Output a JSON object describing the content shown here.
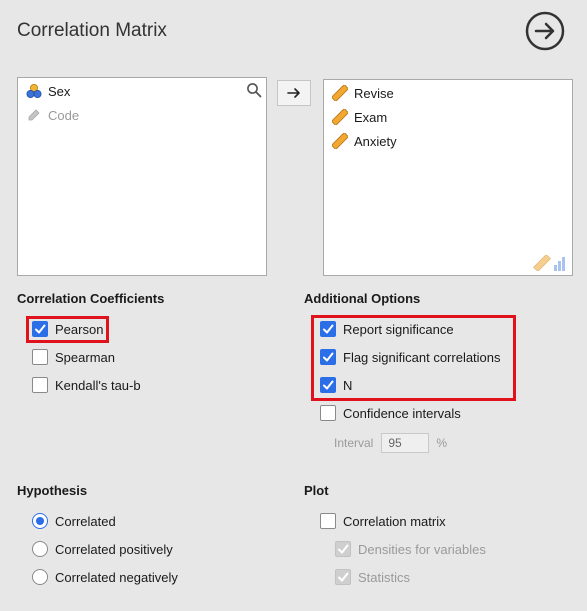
{
  "header": {
    "title": "Correlation Matrix",
    "go_icon": "arrow-circle-right-icon"
  },
  "source_list": {
    "items": [
      {
        "label": "Sex",
        "icon": "nominal-variable-icon"
      },
      {
        "label": "Code",
        "icon": "id-variable-icon",
        "disabled": true
      }
    ],
    "search_icon": "search-icon"
  },
  "transfer_button": {
    "icon": "arrow-right-icon",
    "label": "→"
  },
  "target_list": {
    "items": [
      {
        "label": "Revise",
        "icon": "continuous-variable-icon"
      },
      {
        "label": "Exam",
        "icon": "continuous-variable-icon"
      },
      {
        "label": "Anxiety",
        "icon": "continuous-variable-icon"
      }
    ],
    "allowed_types_icon": "continuous-ordinal-types-icon"
  },
  "correlation_coefficients": {
    "heading": "Correlation Coefficients",
    "options": [
      {
        "label": "Pearson",
        "checked": true
      },
      {
        "label": "Spearman",
        "checked": false
      },
      {
        "label": "Kendall's tau-b",
        "checked": false
      }
    ]
  },
  "additional_options": {
    "heading": "Additional Options",
    "options": [
      {
        "label": "Report significance",
        "checked": true
      },
      {
        "label": "Flag significant correlations",
        "checked": true
      },
      {
        "label": "N",
        "checked": true
      },
      {
        "label": "Confidence intervals",
        "checked": false
      }
    ],
    "interval_label": "Interval",
    "interval_value": "95",
    "interval_unit": "%"
  },
  "hypothesis": {
    "heading": "Hypothesis",
    "options": [
      {
        "label": "Correlated",
        "selected": true
      },
      {
        "label": "Correlated positively",
        "selected": false
      },
      {
        "label": "Correlated negatively",
        "selected": false
      }
    ]
  },
  "plot": {
    "heading": "Plot",
    "options": [
      {
        "label": "Correlation matrix",
        "checked": false
      },
      {
        "label": "Densities for variables",
        "checked": true,
        "disabled": true
      },
      {
        "label": "Statistics",
        "checked": true,
        "disabled": true
      }
    ]
  },
  "colors": {
    "accent": "#2a6ee8",
    "highlight": "#e0121b",
    "background": "#e7e7e7"
  }
}
